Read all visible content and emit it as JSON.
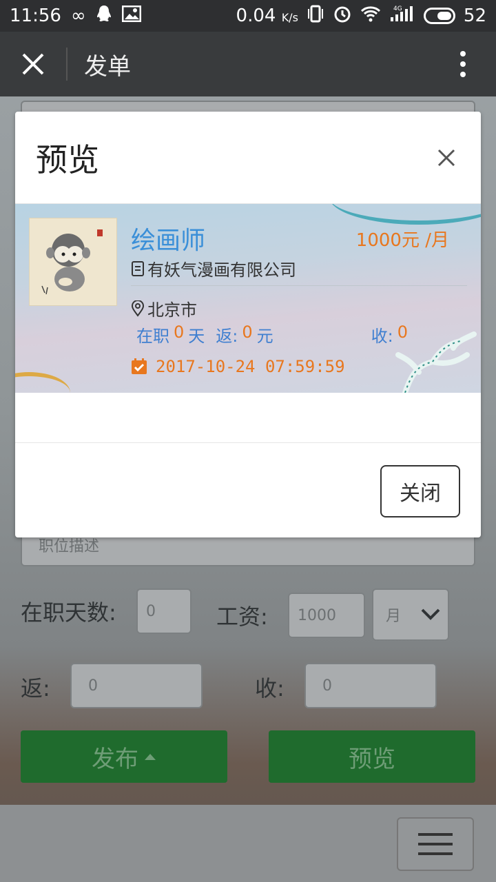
{
  "status_bar": {
    "time": "11:56",
    "speed": "0.04",
    "speed_unit": "K/s",
    "network": "4G",
    "battery": "52"
  },
  "app_bar": {
    "title": "发单"
  },
  "background_form": {
    "description_placeholder": "职位描述",
    "days_label": "在职天数:",
    "days_value": "0",
    "salary_label": "工资:",
    "salary_value": "1000",
    "salary_unit": "月",
    "rebate_label": "返:",
    "rebate_value": "0",
    "receive_label": "收:",
    "receive_value": "0",
    "publish_button": "发布",
    "preview_button": "预览"
  },
  "modal": {
    "title": "预览",
    "close_button": "关闭",
    "card": {
      "job_title": "绘画师",
      "salary": "1000元 /月",
      "company": "有妖气漫画有限公司",
      "location": "北京市",
      "stats": {
        "days_prefix": "在职",
        "days_value": "0",
        "days_suffix": "天",
        "rebate_prefix": "返:",
        "rebate_value": "0",
        "rebate_suffix": "元",
        "receive_prefix": "收:",
        "receive_value": "0"
      },
      "datetime": "2017-10-24 07:59:59"
    }
  },
  "colors": {
    "accent_blue": "#3a8fd8",
    "accent_orange": "#e8771e",
    "button_green": "#1f6b2d"
  }
}
